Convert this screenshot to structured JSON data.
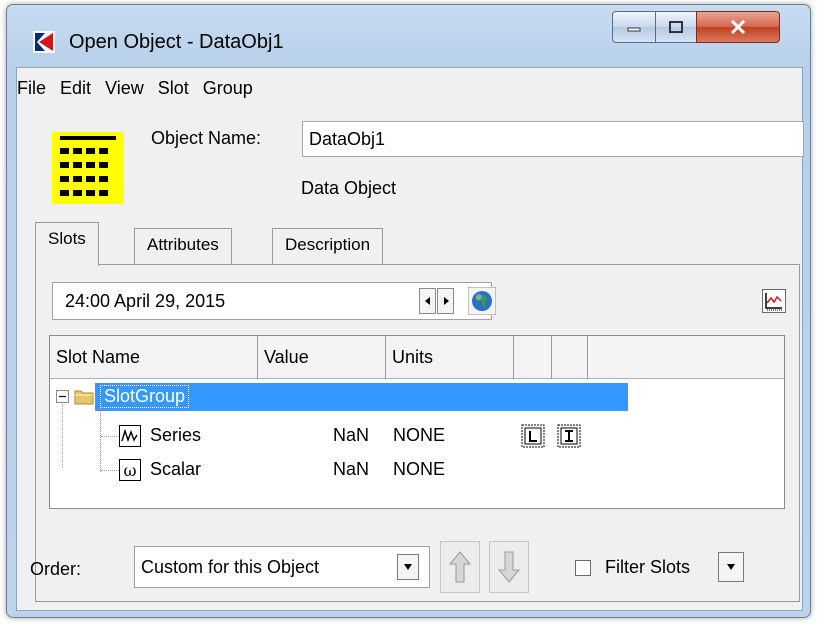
{
  "window": {
    "title": "Open Object - DataObj1"
  },
  "menu": {
    "items": [
      "File",
      "Edit",
      "View",
      "Slot",
      "Group"
    ]
  },
  "object": {
    "name_label": "Object Name:",
    "name_value": "DataObj1",
    "type": "Data Object"
  },
  "tabs": [
    {
      "label": "Slots",
      "active": true
    },
    {
      "label": "Attributes",
      "active": false
    },
    {
      "label": "Description",
      "active": false
    }
  ],
  "timestep": {
    "value": "24:00 April 29, 2015"
  },
  "grid": {
    "columns": [
      "Slot Name",
      "Value",
      "Units",
      "",
      ""
    ],
    "group": {
      "name": "SlotGroup",
      "selected": true
    },
    "rows": [
      {
        "name": "Series",
        "value": "NaN",
        "units": "NONE",
        "icon": "series-slot-icon"
      },
      {
        "name": "Scalar",
        "value": "NaN",
        "units": "NONE",
        "icon": "scalar-slot-icon"
      }
    ]
  },
  "order": {
    "label": "Order:",
    "value": "Custom for this Object"
  },
  "filter": {
    "label": "Filter Slots",
    "checked": false
  }
}
